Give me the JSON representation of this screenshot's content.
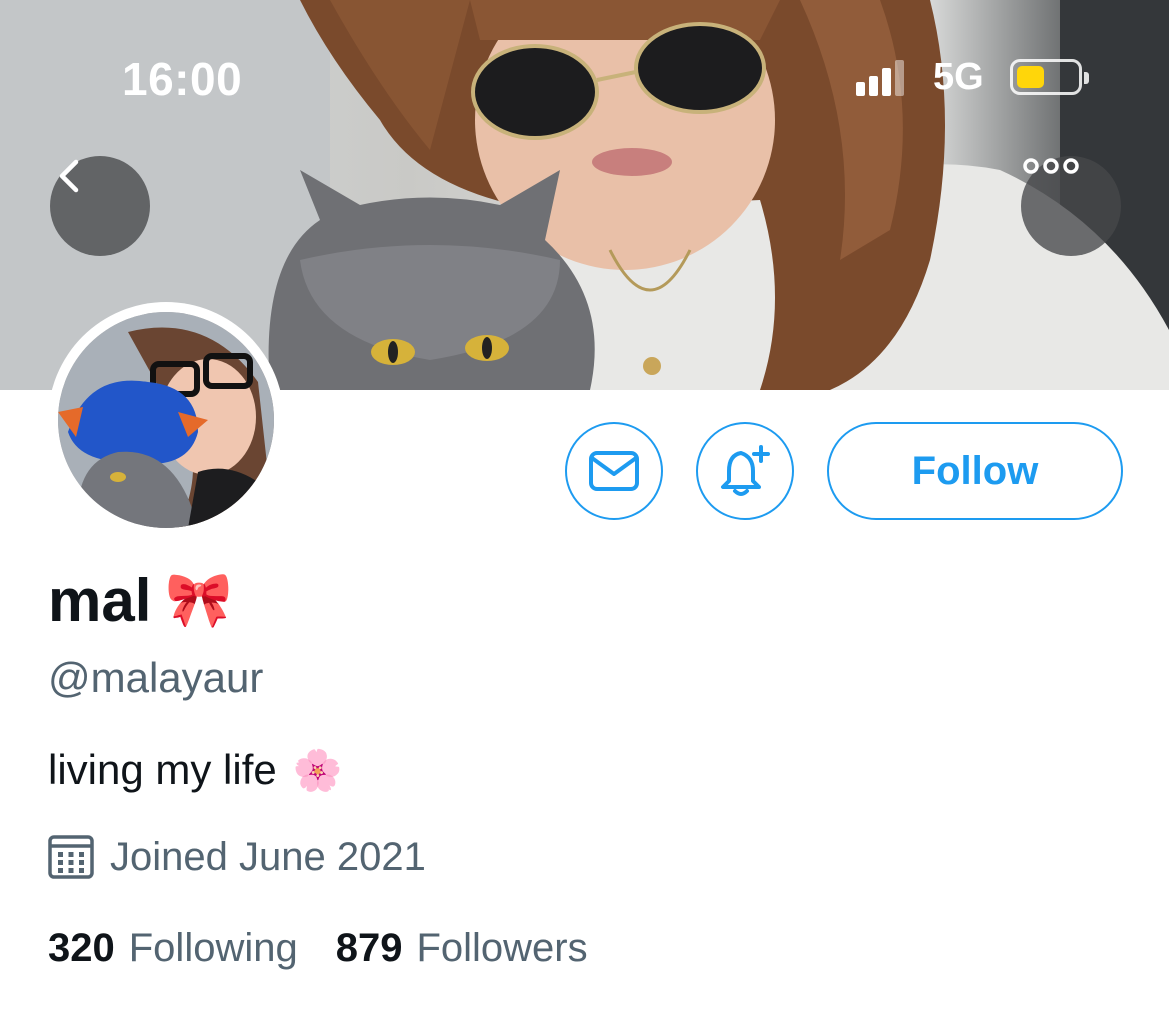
{
  "status_bar": {
    "time": "16:00",
    "network": "5G",
    "battery_level": 0.45,
    "battery_color": "#ffd60a"
  },
  "header": {
    "back_icon": "chevron-left-icon",
    "more_icon": "more-horizontal-icon"
  },
  "actions": {
    "message_icon": "envelope-icon",
    "notify_icon": "bell-plus-icon",
    "follow_label": "Follow"
  },
  "profile": {
    "display_name": "mal",
    "name_emoji": "🎀",
    "handle": "@malayaur",
    "bio": "living my life",
    "bio_emoji": "🌸",
    "joined": "Joined June 2021",
    "joined_icon": "calendar-icon",
    "following_count": "320",
    "following_label": "Following",
    "followers_count": "879",
    "followers_label": "Followers"
  },
  "colors": {
    "accent": "#1d9bf0",
    "secondary_text": "#536471",
    "primary_text": "#0f1419"
  }
}
